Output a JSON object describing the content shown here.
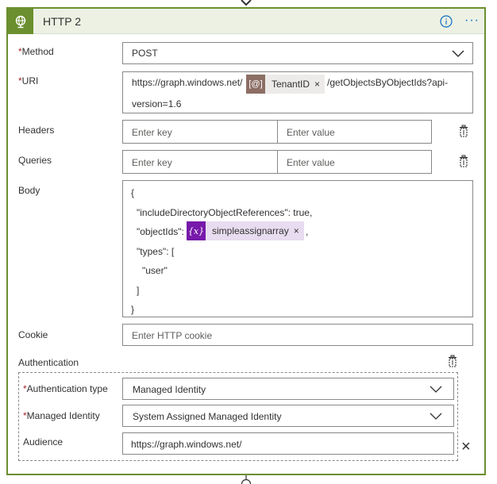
{
  "card": {
    "title": "HTTP 2",
    "icon": "globe-icon",
    "info_icon": "info-icon",
    "more_label": "···"
  },
  "method": {
    "label": "Method",
    "required": "*",
    "value": "POST"
  },
  "uri": {
    "label": "URI",
    "required": "*",
    "prefix": "https://graph.windows.net/",
    "token": {
      "label": "TenantID",
      "icon_text": "[@]",
      "remove": "×",
      "color": "#8c6e64"
    },
    "suffix": "/getObjectsByObjectIds?api-",
    "line2": "version=1.6"
  },
  "headers": {
    "label": "Headers",
    "key_placeholder": "Enter key",
    "value_placeholder": "Enter value"
  },
  "queries": {
    "label": "Queries",
    "key_placeholder": "Enter key",
    "value_placeholder": "Enter value"
  },
  "body": {
    "label": "Body",
    "lines": {
      "l1": "{",
      "l2": "\"includeDirectoryObjectReferences\": true,",
      "l3_prefix": "\"objectIds\":",
      "l4": "\"types\": [",
      "l5": "\"user\"",
      "l6": "]",
      "l7": "}"
    },
    "token": {
      "label": "simpleassignarray",
      "icon_text": "{x}",
      "remove": "×",
      "suffix": ",",
      "color": "#7719aa"
    }
  },
  "cookie": {
    "label": "Cookie",
    "placeholder": "Enter HTTP cookie"
  },
  "authentication": {
    "label": "Authentication",
    "type_label": "Authentication type",
    "type_value": "Managed Identity",
    "identity_label": "Managed Identity",
    "identity_value": "System Assigned Managed Identity",
    "audience_label": "Audience",
    "audience_value": "https://graph.windows.net/",
    "required": "*",
    "remove": "×"
  },
  "colors": {
    "accent_green": "#6b8f2e",
    "header_bg": "#ecf1e4",
    "link_blue": "#0f6cbd",
    "required_red": "#a4262c"
  }
}
